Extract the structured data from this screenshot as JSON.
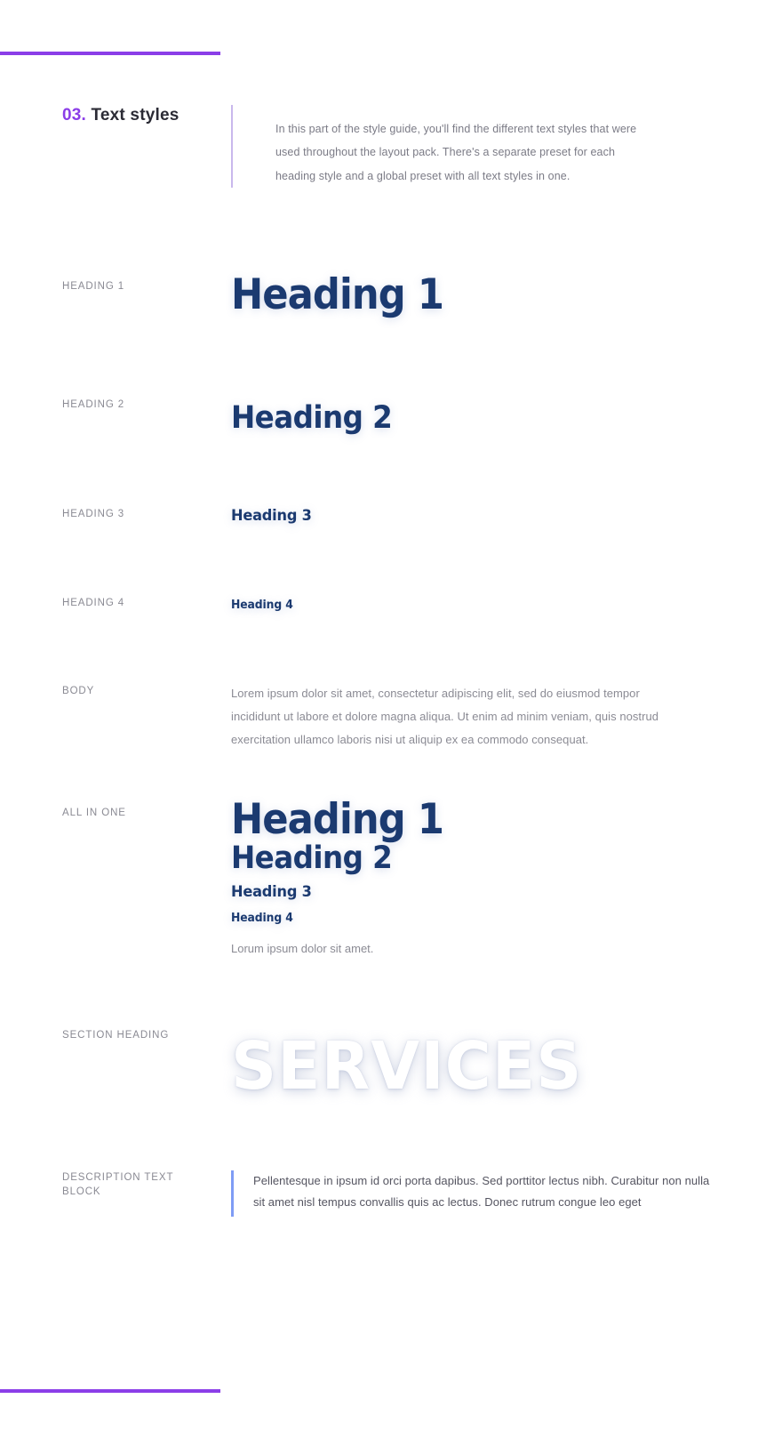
{
  "theme": {
    "accent_purple": "#8b3ee8",
    "heading_navy": "#1b3a70",
    "label_gray": "#8a8a93",
    "body_gray": "#8b8b94",
    "desc_bar_blue": "#7f9cf5",
    "intro_bar_lilac": "#c9b8ec",
    "background": "#ffffff"
  },
  "section": {
    "number": "03.",
    "title": "Text styles",
    "intro": "In this part of the style guide, you'll find the different text styles that were used throughout the layout pack. There's a separate preset for each heading style and a global preset with all text styles in one."
  },
  "rows": {
    "heading1": {
      "label": "HEADING 1",
      "sample": "Heading 1"
    },
    "heading2": {
      "label": "HEADING 2",
      "sample": "Heading 2"
    },
    "heading3": {
      "label": "HEADING 3",
      "sample": "Heading 3"
    },
    "heading4": {
      "label": "HEADING 4",
      "sample": "Heading 4"
    },
    "body": {
      "label": "BODY",
      "sample": "Lorem ipsum dolor sit amet, consectetur adipiscing elit, sed do eiusmod tempor incididunt ut labore et dolore magna aliqua. Ut enim ad minim veniam, quis nostrud exercitation ullamco laboris nisi ut aliquip ex ea commodo consequat."
    },
    "all_in_one": {
      "label": "ALL IN ONE",
      "h1": "Heading 1",
      "h2": "Heading 2",
      "h3": "Heading 3",
      "h4": "Heading 4",
      "body": "Lorum ipsum dolor sit amet."
    },
    "section_heading": {
      "label": "SECTION HEADING",
      "sample": "SERVICES"
    },
    "description_block": {
      "label": "DESCRIPTION TEXT BLOCK",
      "sample": "Pellentesque in ipsum id orci porta dapibus. Sed porttitor lectus nibh. Curabitur non nulla sit amet nisl tempus convallis quis ac lectus. Donec rutrum congue leo eget"
    }
  }
}
